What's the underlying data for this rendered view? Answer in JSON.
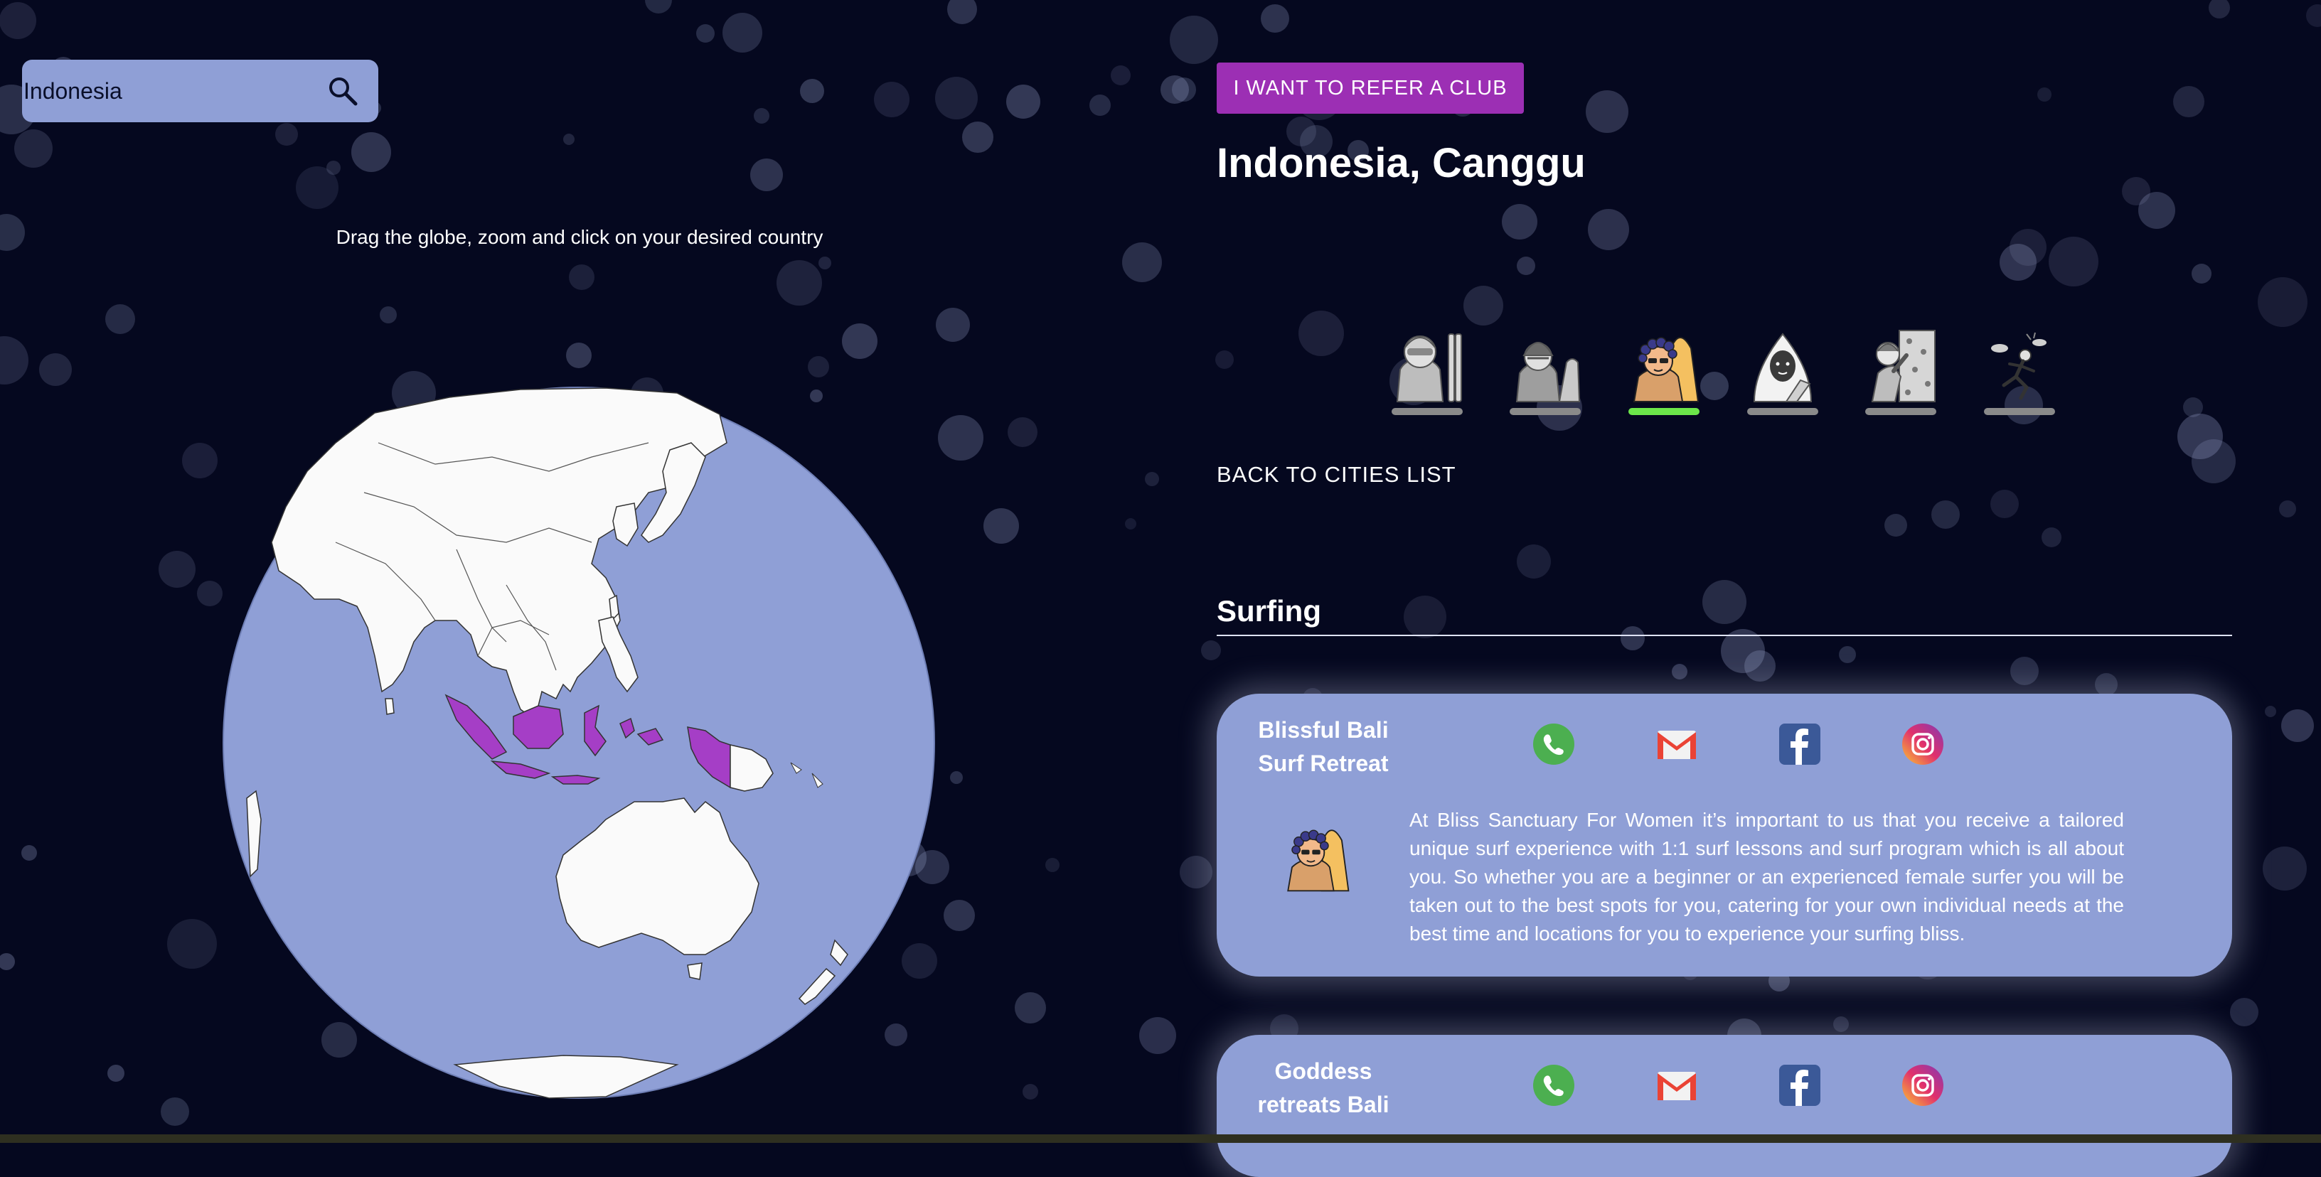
{
  "search": {
    "value": "Indonesia",
    "icon": "search-icon"
  },
  "globe": {
    "hint": "Drag the globe, zoom and click on your desired country",
    "ocean_color": "#8f9fd6",
    "land_color": "#fafafa",
    "highlight_color": "#a53ec6",
    "highlighted_country": "Indonesia"
  },
  "refer_button": "I WANT TO REFER A CLUB",
  "city_title": "Indonesia, Canggu",
  "avatars": [
    {
      "icon": "skier-icon",
      "active": false
    },
    {
      "icon": "hiker-icon",
      "active": false
    },
    {
      "icon": "surfer-icon",
      "active": true
    },
    {
      "icon": "hijab-woman-icon",
      "active": false
    },
    {
      "icon": "climber-icon",
      "active": false
    },
    {
      "icon": "runner-icon",
      "active": false
    }
  ],
  "back_link": "BACK TO CITIES LIST",
  "section": {
    "title": "Surfing"
  },
  "clubs": [
    {
      "name": "Blissful Bali Surf Retreat",
      "name_lines": [
        "Blissful Bali",
        "Surf Retreat"
      ],
      "socials": [
        "whatsapp-icon",
        "gmail-icon",
        "facebook-icon",
        "instagram-icon"
      ],
      "avatar": "surfer-icon",
      "description": "At Bliss Sanctuary For Women it’s important to us that you receive a tailored unique surf experience with 1:1 surf lessons and surf program which is all about you. So whether you are a beginner or an experienced female surfer you will be taken out to the best spots for you, catering for your own individual needs at the best time and locations for you to experience your surfing bliss."
    },
    {
      "name": "Goddess retreats Bali",
      "name_lines": [
        "Goddess",
        "retreats Bali"
      ],
      "socials": [
        "whatsapp-icon",
        "gmail-icon",
        "facebook-icon",
        "instagram-icon"
      ]
    }
  ],
  "colors": {
    "background": "#05081f",
    "accent_purple": "#9c2fb4",
    "card": "#8f9fd6",
    "active_indicator": "#6ce64a"
  }
}
